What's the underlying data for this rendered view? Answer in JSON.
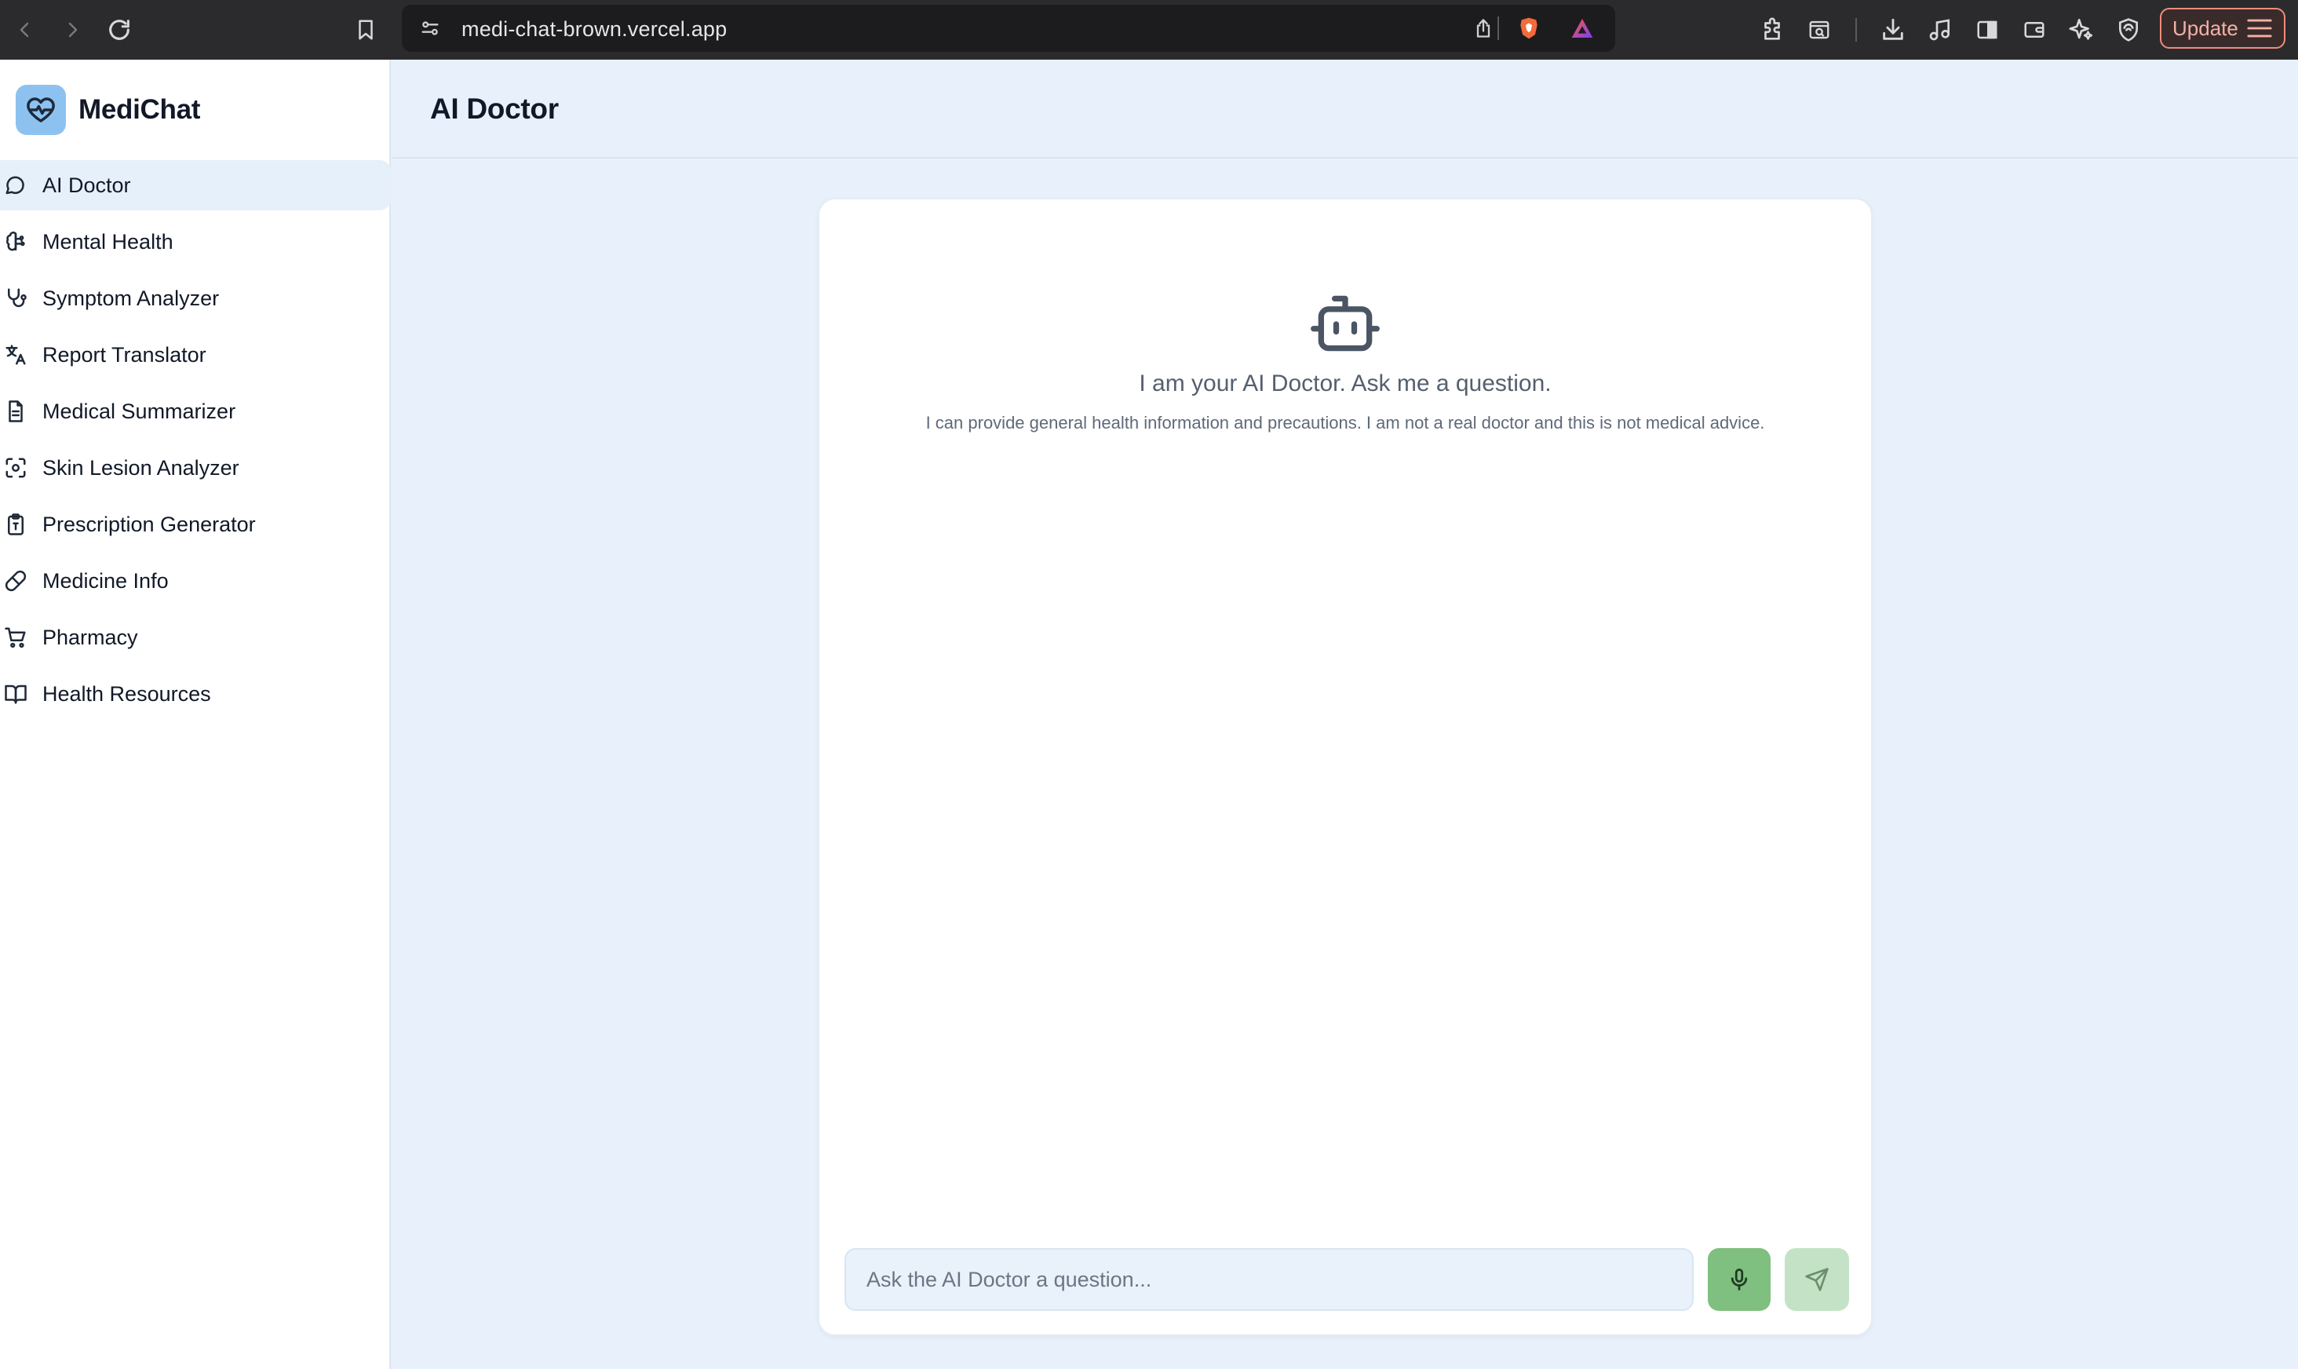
{
  "browser": {
    "url": "medi-chat-brown.vercel.app",
    "update_label": "Update",
    "icons": [
      "back-icon",
      "forward-icon",
      "reload-icon",
      "bookmark-icon",
      "site-settings-icon",
      "share-icon",
      "brave-shields-icon",
      "brave-rewards-icon",
      "extensions-icon",
      "search-tab-icon",
      "downloads-icon",
      "media-icon",
      "sidebar-icon",
      "wallet-icon",
      "leo-icon",
      "vpn-icon",
      "menu-icon"
    ]
  },
  "sidebar": {
    "brand": "MediChat",
    "items": [
      {
        "label": "AI Doctor",
        "icon": "chat-bubble-icon",
        "active": true
      },
      {
        "label": "Mental Health",
        "icon": "brain-icon",
        "active": false
      },
      {
        "label": "Symptom Analyzer",
        "icon": "stethoscope-icon",
        "active": false
      },
      {
        "label": "Report Translator",
        "icon": "translate-icon",
        "active": false
      },
      {
        "label": "Medical Summarizer",
        "icon": "document-icon",
        "active": false
      },
      {
        "label": "Skin Lesion Analyzer",
        "icon": "scan-face-icon",
        "active": false
      },
      {
        "label": "Prescription Generator",
        "icon": "clipboard-icon",
        "active": false
      },
      {
        "label": "Medicine Info",
        "icon": "pill-icon",
        "active": false
      },
      {
        "label": "Pharmacy",
        "icon": "cart-icon",
        "active": false
      },
      {
        "label": "Health Resources",
        "icon": "book-icon",
        "active": false
      }
    ]
  },
  "header": {
    "title": "AI Doctor"
  },
  "chat": {
    "empty_title": "I am your AI Doctor. Ask me a question.",
    "empty_subtitle": "I can provide general health information and precautions. I am not a real doctor and this is not medical advice.",
    "input_placeholder": "Ask the AI Doctor a question...",
    "input_value": ""
  },
  "colors": {
    "accent": "#8dc2f0",
    "mic_button": "#7fbf7f",
    "send_button": "#c4e3c6",
    "background": "#e8f1fb"
  }
}
